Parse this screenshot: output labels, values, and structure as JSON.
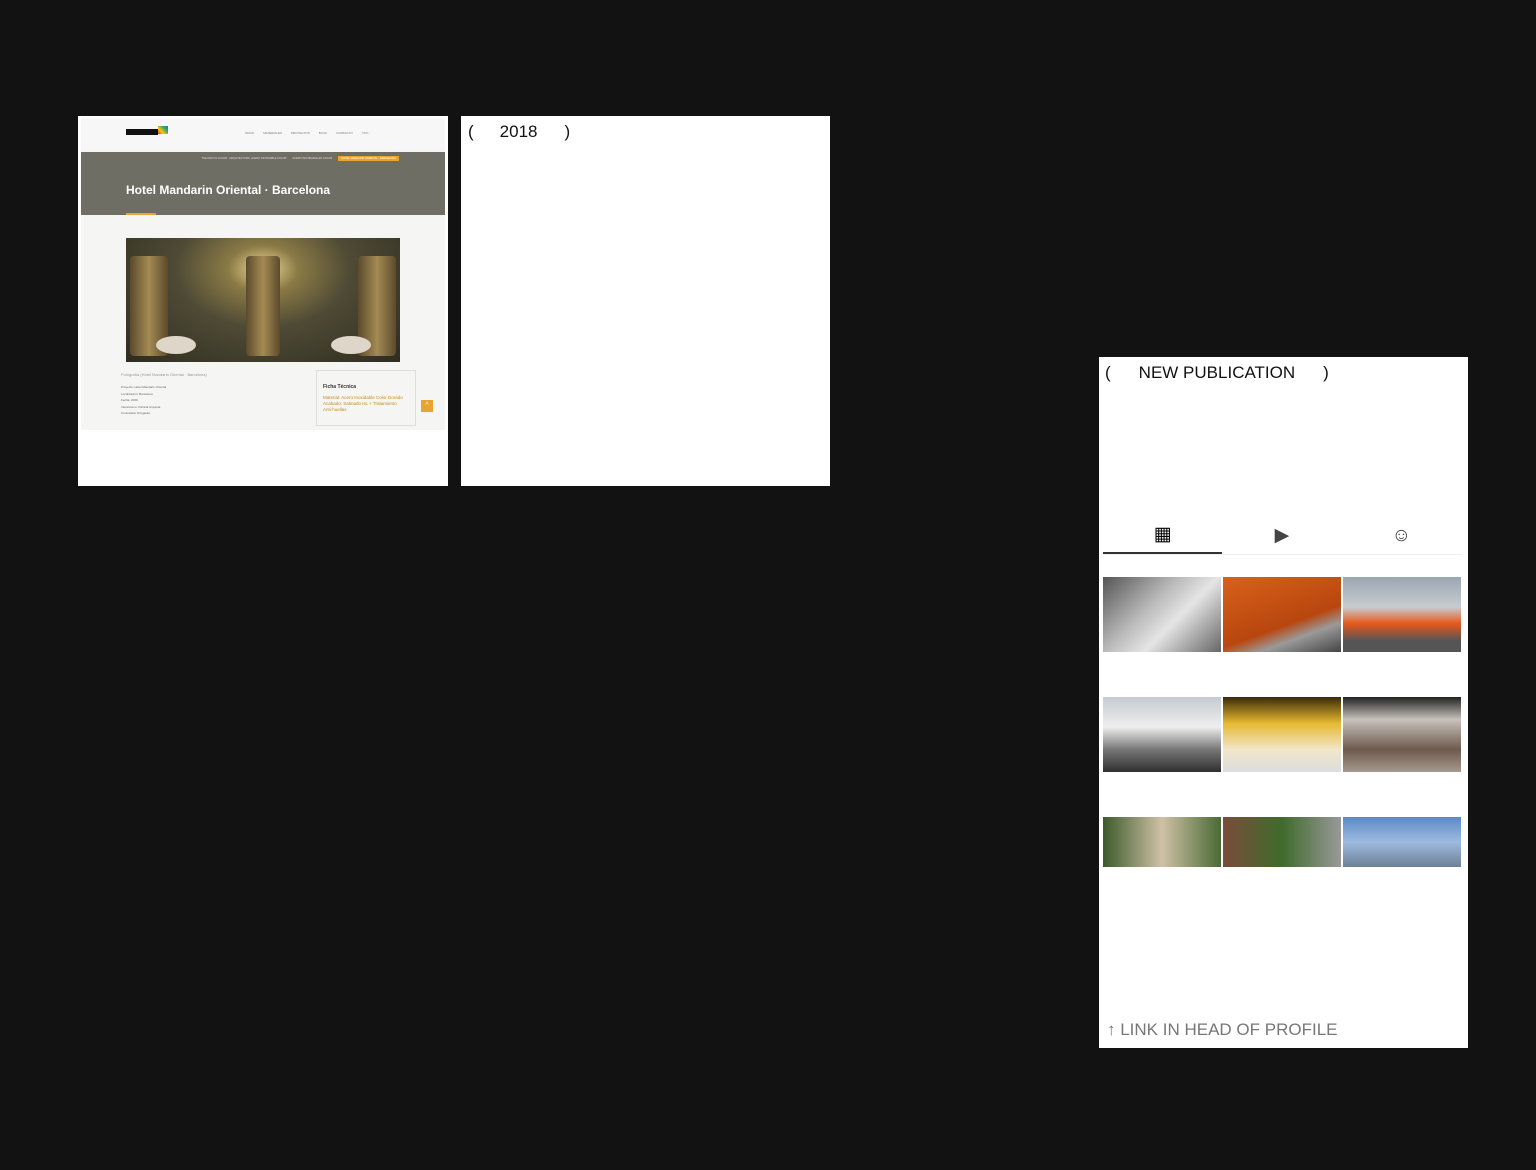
{
  "website_preview": {
    "nav": [
      "INICIO",
      "MATERIALES",
      "PROYECTOS",
      "BLOG",
      "CONTACTO"
    ],
    "social_icons": [
      "facebook-icon",
      "twitter-icon",
      "instagram-icon",
      "youtube-icon"
    ],
    "breadcrumbs": [
      "THE INOX IN COLOR · ARQUITECTURA, ACERO INOXIDABLE COLOR",
      "ACERO INOXIDABLE EN COLOR",
      "HOTEL MANDARIN ORIENTAL · BARCELONA"
    ],
    "title": "Hotel Mandarin Oriental · Barcelona",
    "caption": "Fotografía (Hotel Mandarin Oriental · Barcelona)",
    "details": [
      "Proyecto: Hotel Mandarin Oriental",
      "Localización: Barcelona",
      "Fecha: 2009",
      "Interiorismo: Patricia Urquiola",
      "Contratista: Drugasko"
    ],
    "ficha": {
      "title": "Ficha Técnica",
      "lines": [
        "Material: Acero Inoxidable Color Dorado",
        "Acabado: Satinado HL + Tratamiento",
        "Anti-huellas"
      ]
    }
  },
  "year_card": {
    "open": "(",
    "label": "2018",
    "close": ")"
  },
  "profile_card": {
    "open": "(",
    "label": "NEW PUBLICATION",
    "close": ")",
    "tabs": [
      "grid-icon",
      "reels-icon",
      "tagged-icon"
    ],
    "footer": "↑ LINK IN HEAD OF PROFILE"
  }
}
